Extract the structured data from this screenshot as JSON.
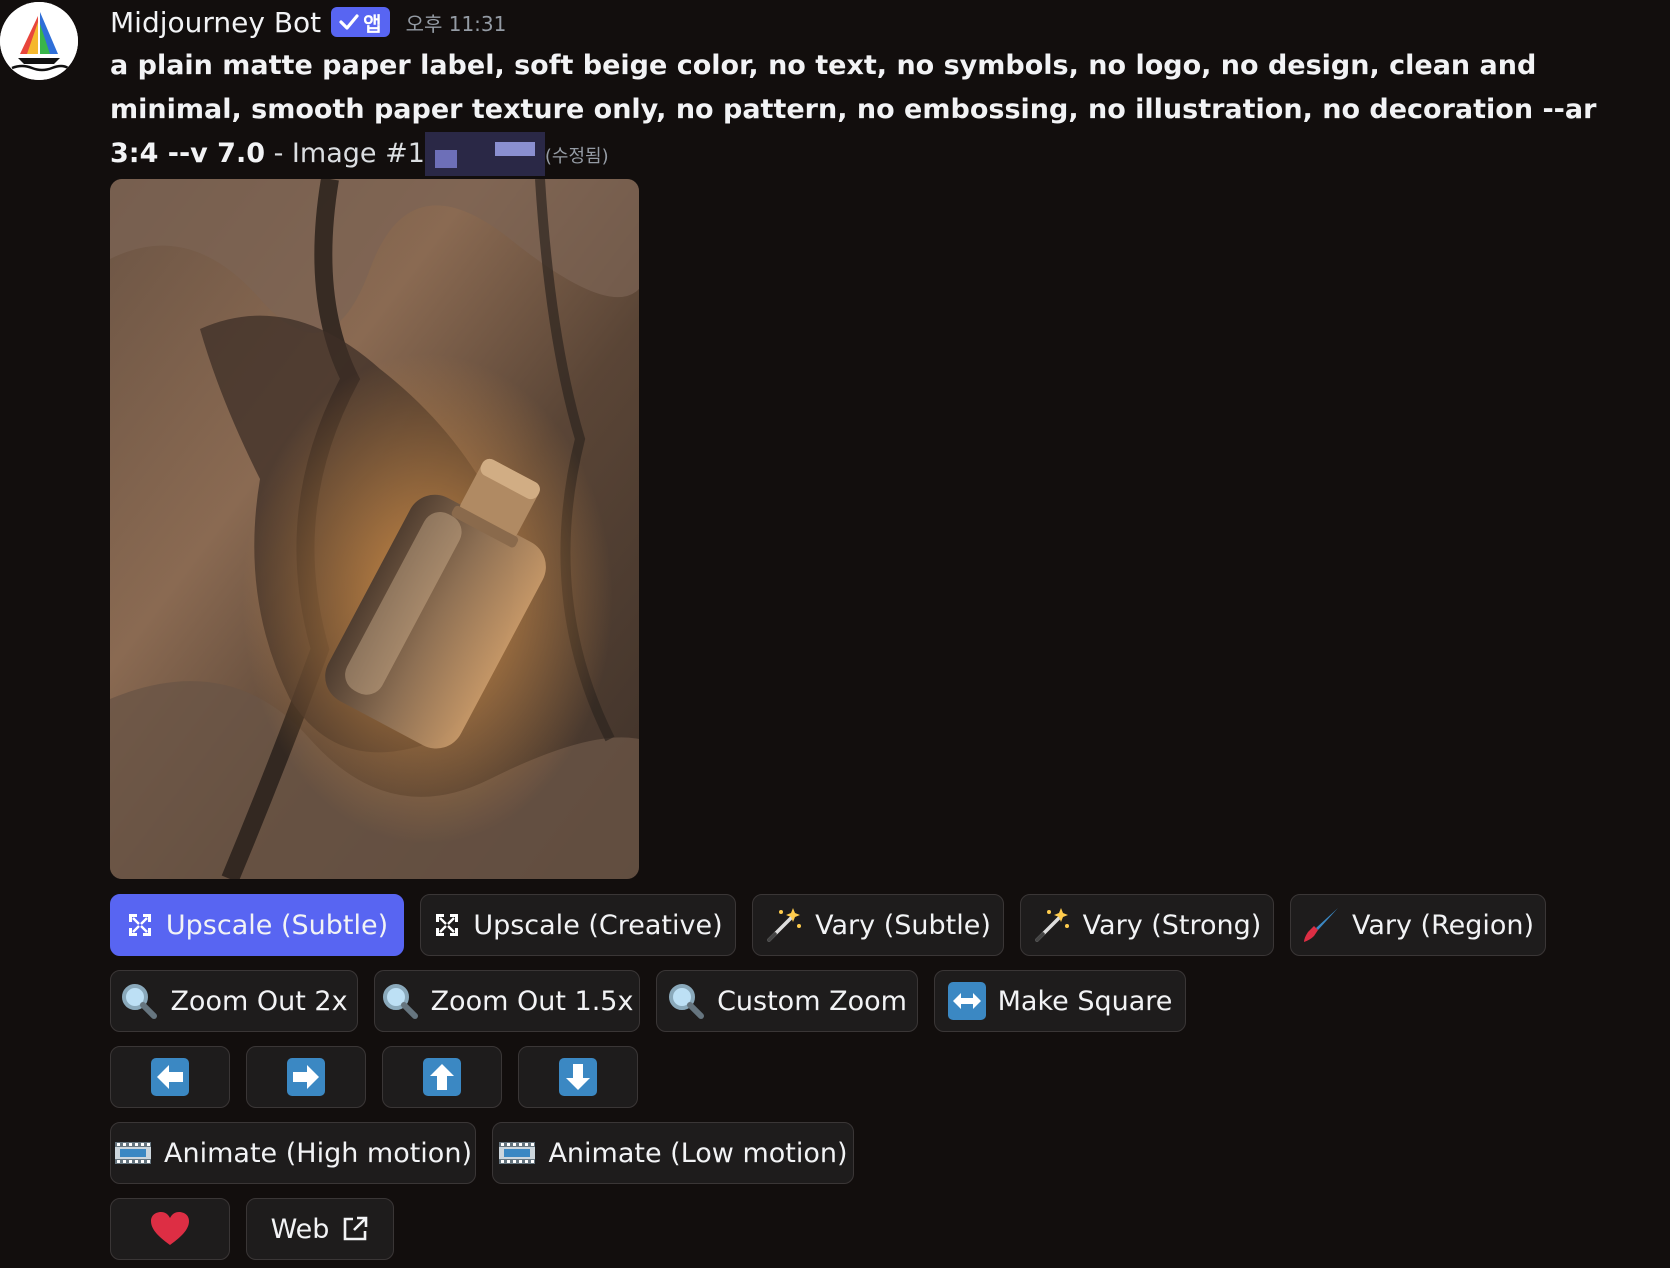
{
  "header": {
    "username": "Midjourney Bot",
    "app_badge": "앱",
    "timestamp": "오후 11:31"
  },
  "message": {
    "prompt": "a plain matte paper label, soft beige color, no text, no symbols, no logo, no design, clean and minimal, smooth paper texture only, no pattern, no embossing, no illustration, no decoration --ar 3:4 --v 7.0",
    "suffix": " - Image #1",
    "edited": "(수정됨)"
  },
  "image": {
    "subject": "glass bottle with wooden cap lying in a cracked rock crevice"
  },
  "buttons": {
    "row1": [
      {
        "label": "Upscale (Subtle)",
        "icon": "upscale-icon",
        "active": true
      },
      {
        "label": "Upscale (Creative)",
        "icon": "upscale-icon"
      },
      {
        "label": "Vary (Subtle)",
        "icon": "magic-wand-icon"
      },
      {
        "label": "Vary (Strong)",
        "icon": "magic-wand-icon"
      },
      {
        "label": "Vary (Region)",
        "icon": "paintbrush-icon"
      }
    ],
    "row2": [
      {
        "label": "Zoom Out 2x",
        "icon": "magnifier-icon"
      },
      {
        "label": "Zoom Out 1.5x",
        "icon": "magnifier-icon"
      },
      {
        "label": "Custom Zoom",
        "icon": "magnifier-icon"
      },
      {
        "label": "Make Square",
        "icon": "left-right-arrow-icon"
      }
    ],
    "row3": [
      {
        "icon": "arrow-left-icon"
      },
      {
        "icon": "arrow-right-icon"
      },
      {
        "icon": "arrow-up-icon"
      },
      {
        "icon": "arrow-down-icon"
      }
    ],
    "row4": [
      {
        "label": "Animate (High motion)",
        "icon": "film-icon"
      },
      {
        "label": "Animate (Low motion)",
        "icon": "film-icon"
      }
    ],
    "row5": [
      {
        "icon": "heart-icon"
      },
      {
        "label": "Web",
        "icon": "external-link-icon"
      }
    ]
  },
  "colors": {
    "background": "#120e0d",
    "accent": "#5865f2",
    "button_bg": "#1e1c1c",
    "arrow_blue": "#3b88c3",
    "heart_red": "#dd2e44"
  }
}
